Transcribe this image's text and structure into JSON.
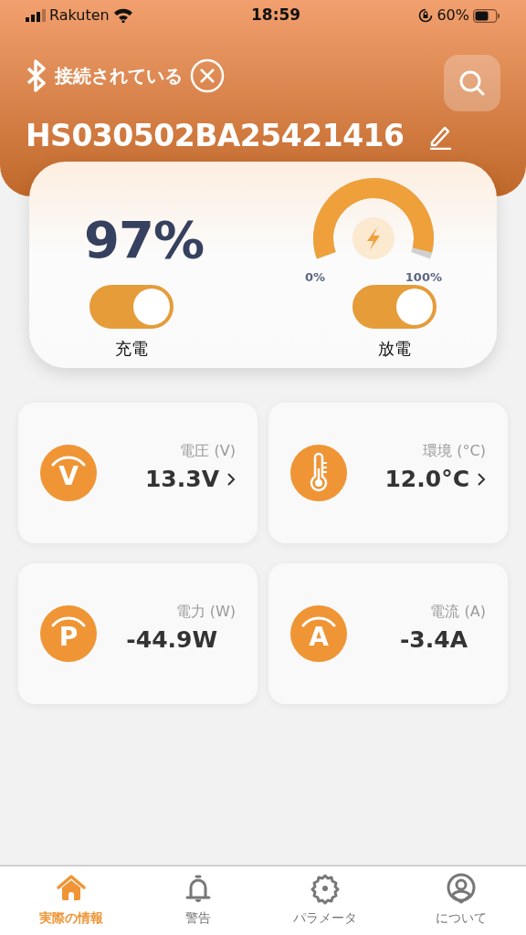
{
  "status_bar": {
    "carrier": "Rakuten",
    "time": "18:59",
    "battery": "60%"
  },
  "header": {
    "connection": "接続されている",
    "device_name": "HS030502BA25421416"
  },
  "summary": {
    "percent": "97%",
    "gauge": {
      "min_label": "0%",
      "max_label": "100%"
    },
    "switches": [
      {
        "label": "充電",
        "on": true
      },
      {
        "label": "放電",
        "on": true
      }
    ]
  },
  "metrics": [
    {
      "kind": "letter",
      "symbol": "V",
      "label": "電圧 (V)",
      "value": "13.3V",
      "has_detail": true
    },
    {
      "kind": "thermometer",
      "label": "環境 (°C)",
      "value": "12.0°C",
      "has_detail": true
    },
    {
      "kind": "letter",
      "symbol": "P",
      "label": "電力 (W)",
      "value": "-44.9W",
      "has_detail": false
    },
    {
      "kind": "letter",
      "symbol": "A",
      "label": "電流 (A)",
      "value": "-3.4A",
      "has_detail": false
    }
  ],
  "tabs": [
    {
      "label": "実際の情報",
      "kind": "home",
      "selected": true
    },
    {
      "label": "警告",
      "kind": "bell",
      "selected": false
    },
    {
      "label": "パラメータ",
      "kind": "gear",
      "selected": false
    },
    {
      "label": "について",
      "kind": "user",
      "selected": false
    }
  ]
}
